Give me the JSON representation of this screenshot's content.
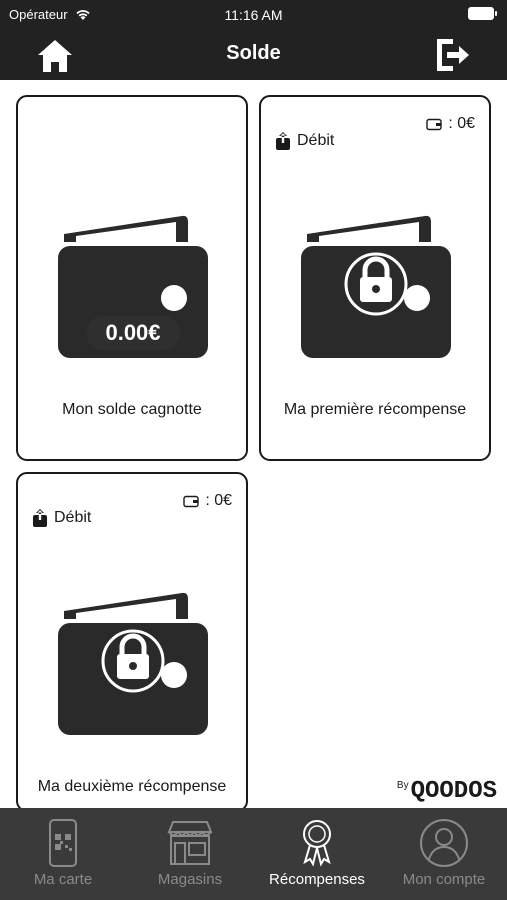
{
  "status_bar": {
    "carrier": "Opérateur",
    "time": "11:16 AM"
  },
  "nav": {
    "title": "Solde",
    "home_icon": "home-icon",
    "logout_icon": "logout-icon"
  },
  "cards": [
    {
      "label": "Mon solde cagnotte",
      "amount": "0.00€"
    },
    {
      "label": "Ma première récompense",
      "debit": "Débit",
      "balance": ": 0€"
    },
    {
      "label": "Ma deuxième récompense",
      "debit": "Débit",
      "balance": ": 0€"
    }
  ],
  "brand": {
    "by": "By",
    "name": "QOODOS"
  },
  "tabs": [
    {
      "label": "Ma carte",
      "icon": "qr-card-icon"
    },
    {
      "label": "Magasins",
      "icon": "shop-icon"
    },
    {
      "label": "Récompenses",
      "icon": "medal-icon",
      "active": true
    },
    {
      "label": "Mon compte",
      "icon": "account-icon"
    }
  ],
  "colors": {
    "bar": "#222222",
    "tab_bar": "#3a3a3a",
    "tab_inactive": "#8a8a8a",
    "tab_active": "#ffffff"
  }
}
